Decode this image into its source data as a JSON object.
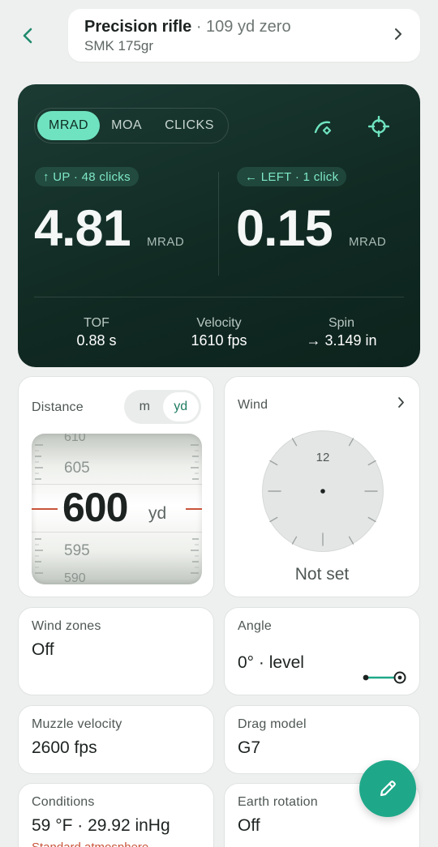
{
  "header": {
    "profile_name": "Precision rifle",
    "profile_zero": " · 109 yd zero",
    "profile_ammo": "SMK 175gr"
  },
  "solution": {
    "units": [
      "MRAD",
      "MOA",
      "CLICKS"
    ],
    "active_unit": "MRAD",
    "elevation": {
      "chip": "↑ UP · 48 clicks",
      "value": "4.81",
      "unit": "MRAD"
    },
    "windage": {
      "chip": "← LEFT · 1 click",
      "value": "0.15",
      "unit": "MRAD"
    },
    "stats": [
      {
        "label": "TOF",
        "value": "0.88 s"
      },
      {
        "label": "Velocity",
        "value": "1610 fps"
      },
      {
        "label": "Spin",
        "value": "→ 3.149 in"
      }
    ]
  },
  "distance": {
    "label": "Distance",
    "unit_options": [
      "m",
      "yd"
    ],
    "selected_unit": "yd",
    "drum_values": [
      "610",
      "605",
      "595",
      "590"
    ],
    "current_value": "600",
    "current_unit": "yd"
  },
  "wind": {
    "label": "Wind",
    "clock_label": "12",
    "status": "Not set"
  },
  "wind_zones": {
    "label": "Wind zones",
    "value": "Off"
  },
  "angle": {
    "label": "Angle",
    "value": "0° · level"
  },
  "muzzle_velocity": {
    "label": "Muzzle velocity",
    "value": "2600 fps"
  },
  "drag_model": {
    "label": "Drag model",
    "value": "G7"
  },
  "conditions": {
    "label": "Conditions",
    "value": "59 °F · 29.92 inHg",
    "subtitle": "Standard atmosphere"
  },
  "earth_rotation": {
    "label": "Earth rotation",
    "value": "Off"
  },
  "colors": {
    "accent": "#6fe3bf",
    "brand": "#1ea889",
    "dark_card": "#123029",
    "warning": "#c9553b"
  }
}
